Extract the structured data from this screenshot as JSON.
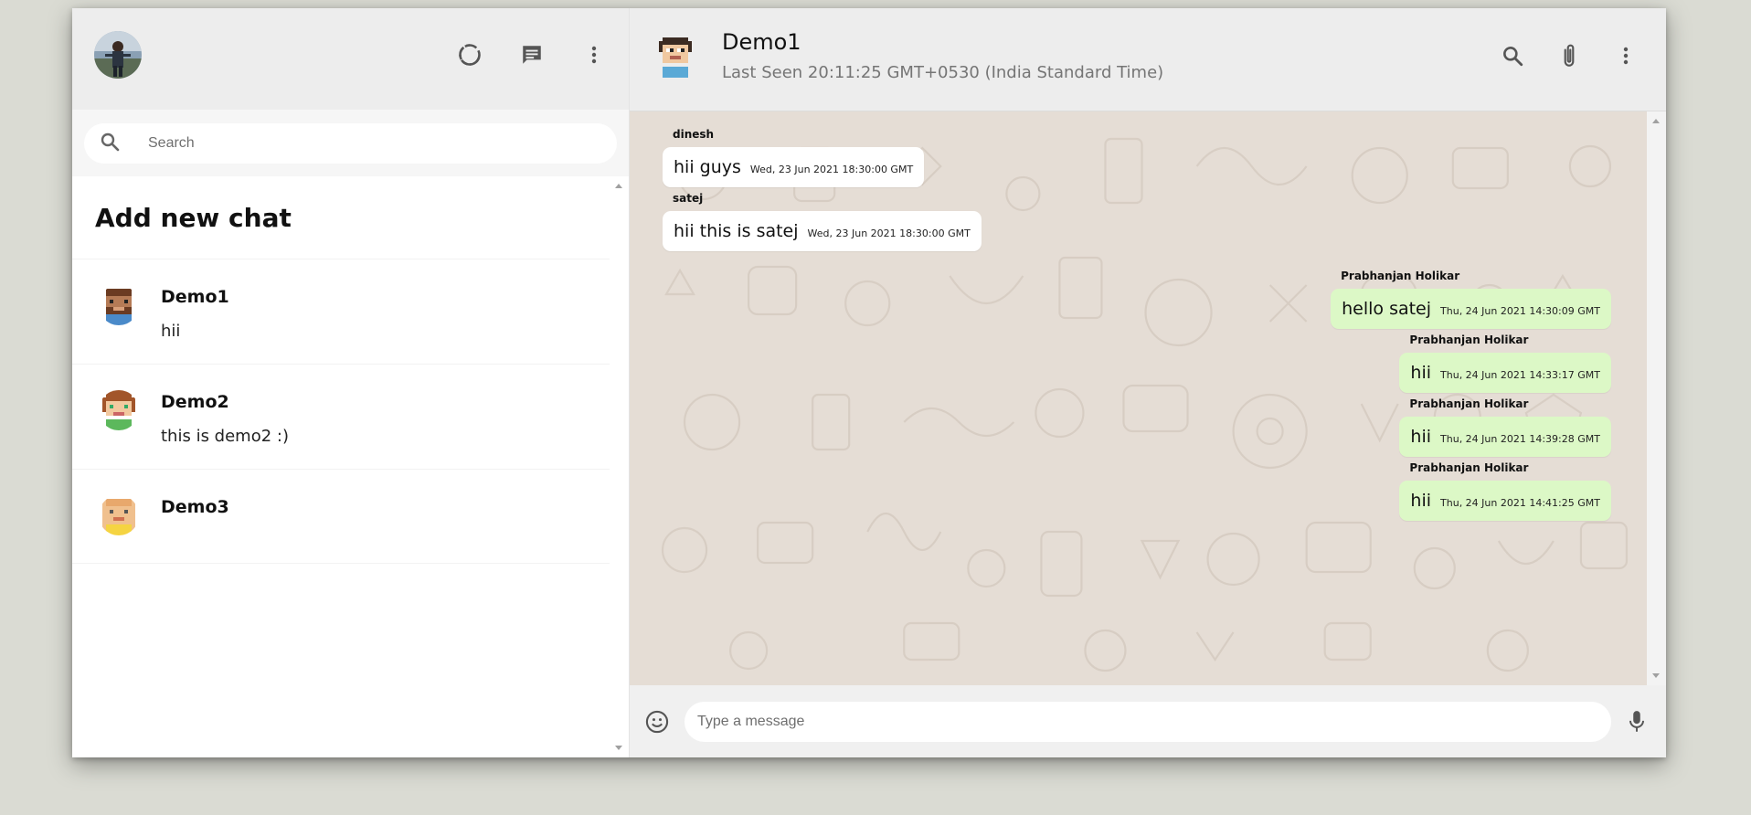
{
  "sidebar": {
    "search_placeholder": "Search",
    "add_new_chat": "Add new chat",
    "chats": [
      {
        "name": "Demo1",
        "last_message": "hii"
      },
      {
        "name": "Demo2",
        "last_message": "this is demo2 :)"
      },
      {
        "name": "Demo3",
        "last_message": ""
      }
    ]
  },
  "chat": {
    "name": "Demo1",
    "last_seen": "Last Seen 20:11:25 GMT+0530 (India Standard Time)",
    "messages": [
      {
        "sender": "dinesh",
        "text": "hii guys",
        "time": "Wed, 23 Jun 2021 18:30:00 GMT",
        "mine": false
      },
      {
        "sender": "satej",
        "text": "hii this is satej",
        "time": "Wed, 23 Jun 2021 18:30:00 GMT",
        "mine": false
      },
      {
        "sender": "Prabhanjan Holikar",
        "text": "hello satej",
        "time": "Thu, 24 Jun 2021 14:30:09 GMT",
        "mine": true
      },
      {
        "sender": "Prabhanjan Holikar",
        "text": "hii",
        "time": "Thu, 24 Jun 2021 14:33:17 GMT",
        "mine": true
      },
      {
        "sender": "Prabhanjan Holikar",
        "text": "hii",
        "time": "Thu, 24 Jun 2021 14:39:28 GMT",
        "mine": true
      },
      {
        "sender": "Prabhanjan Holikar",
        "text": "hii",
        "time": "Thu, 24 Jun 2021 14:41:25 GMT",
        "mine": true
      }
    ],
    "composer_placeholder": "Type a message"
  },
  "icons": {
    "status": "status-icon",
    "new_chat": "chat-icon",
    "menu": "more-vert-icon",
    "search": "search-icon",
    "attach": "attach-icon",
    "emoji": "emoji-icon",
    "mic": "mic-icon"
  },
  "colors": {
    "header_bg": "#ededed",
    "chat_bg": "#e5ddd5",
    "outgoing_bubble": "#dcf8c6",
    "incoming_bubble": "#ffffff"
  }
}
